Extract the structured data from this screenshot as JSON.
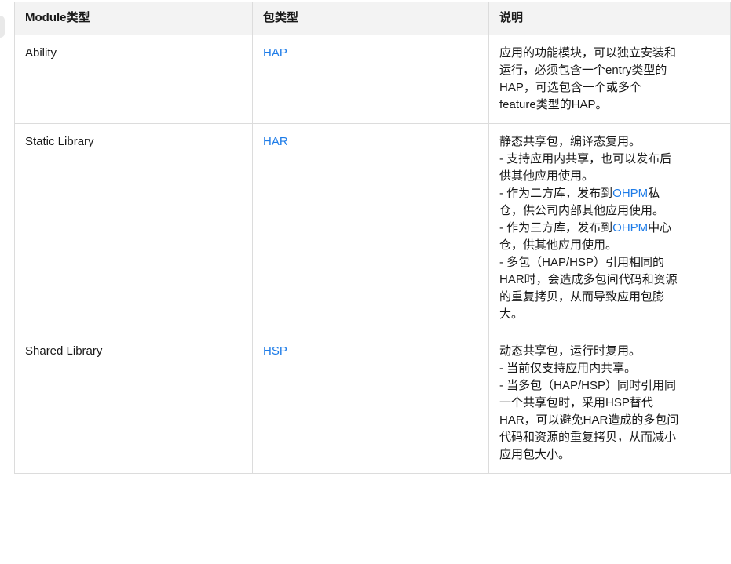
{
  "table": {
    "headers": [
      "Module类型",
      "包类型",
      "说明"
    ],
    "rows": [
      {
        "module_type": "Ability",
        "package_type": "HAP",
        "description_lines": [
          [
            {
              "text": "应用的功能模块，可以独立安装和"
            }
          ],
          [
            {
              "text": "运行，必须包含一个entry类型的"
            }
          ],
          [
            {
              "text": "HAP，可选包含一个或多个"
            }
          ],
          [
            {
              "text": "feature类型的HAP。"
            }
          ]
        ]
      },
      {
        "module_type": "Static Library",
        "package_type": "HAR",
        "description_lines": [
          [
            {
              "text": "静态共享包，编译态复用。"
            }
          ],
          [
            {
              "text": "- 支持应用内共享，也可以发布后"
            }
          ],
          [
            {
              "text": "供其他应用使用。"
            }
          ],
          [
            {
              "text": "- 作为二方库，发布到"
            },
            {
              "text": "OHPM",
              "link": true
            },
            {
              "text": "私"
            }
          ],
          [
            {
              "text": "仓，供公司内部其他应用使用。"
            }
          ],
          [
            {
              "text": "- 作为三方库，发布到"
            },
            {
              "text": "OHPM",
              "link": true
            },
            {
              "text": "中心"
            }
          ],
          [
            {
              "text": "仓，供其他应用使用。"
            }
          ],
          [
            {
              "text": "- 多包（HAP/HSP）引用相同的"
            }
          ],
          [
            {
              "text": "HAR时，会造成多包间代码和资源"
            }
          ],
          [
            {
              "text": "的重复拷贝，从而导致应用包膨"
            }
          ],
          [
            {
              "text": "大。"
            }
          ]
        ]
      },
      {
        "module_type": "Shared Library",
        "package_type": "HSP",
        "description_lines": [
          [
            {
              "text": "动态共享包，运行时复用。"
            }
          ],
          [
            {
              "text": "- 当前仅支持应用内共享。"
            }
          ],
          [
            {
              "text": "- 当多包（HAP/HSP）同时引用同"
            }
          ],
          [
            {
              "text": "一个共享包时，采用HSP替代"
            }
          ],
          [
            {
              "text": "HAR，可以避免HAR造成的多包间"
            }
          ],
          [
            {
              "text": "代码和资源的重复拷贝，从而减小"
            }
          ],
          [
            {
              "text": "应用包大小。"
            }
          ]
        ]
      }
    ]
  },
  "colors": {
    "link": "#1e7ce8",
    "header_bg": "#f3f3f3",
    "border": "#dcdcdc",
    "text": "#191919"
  }
}
